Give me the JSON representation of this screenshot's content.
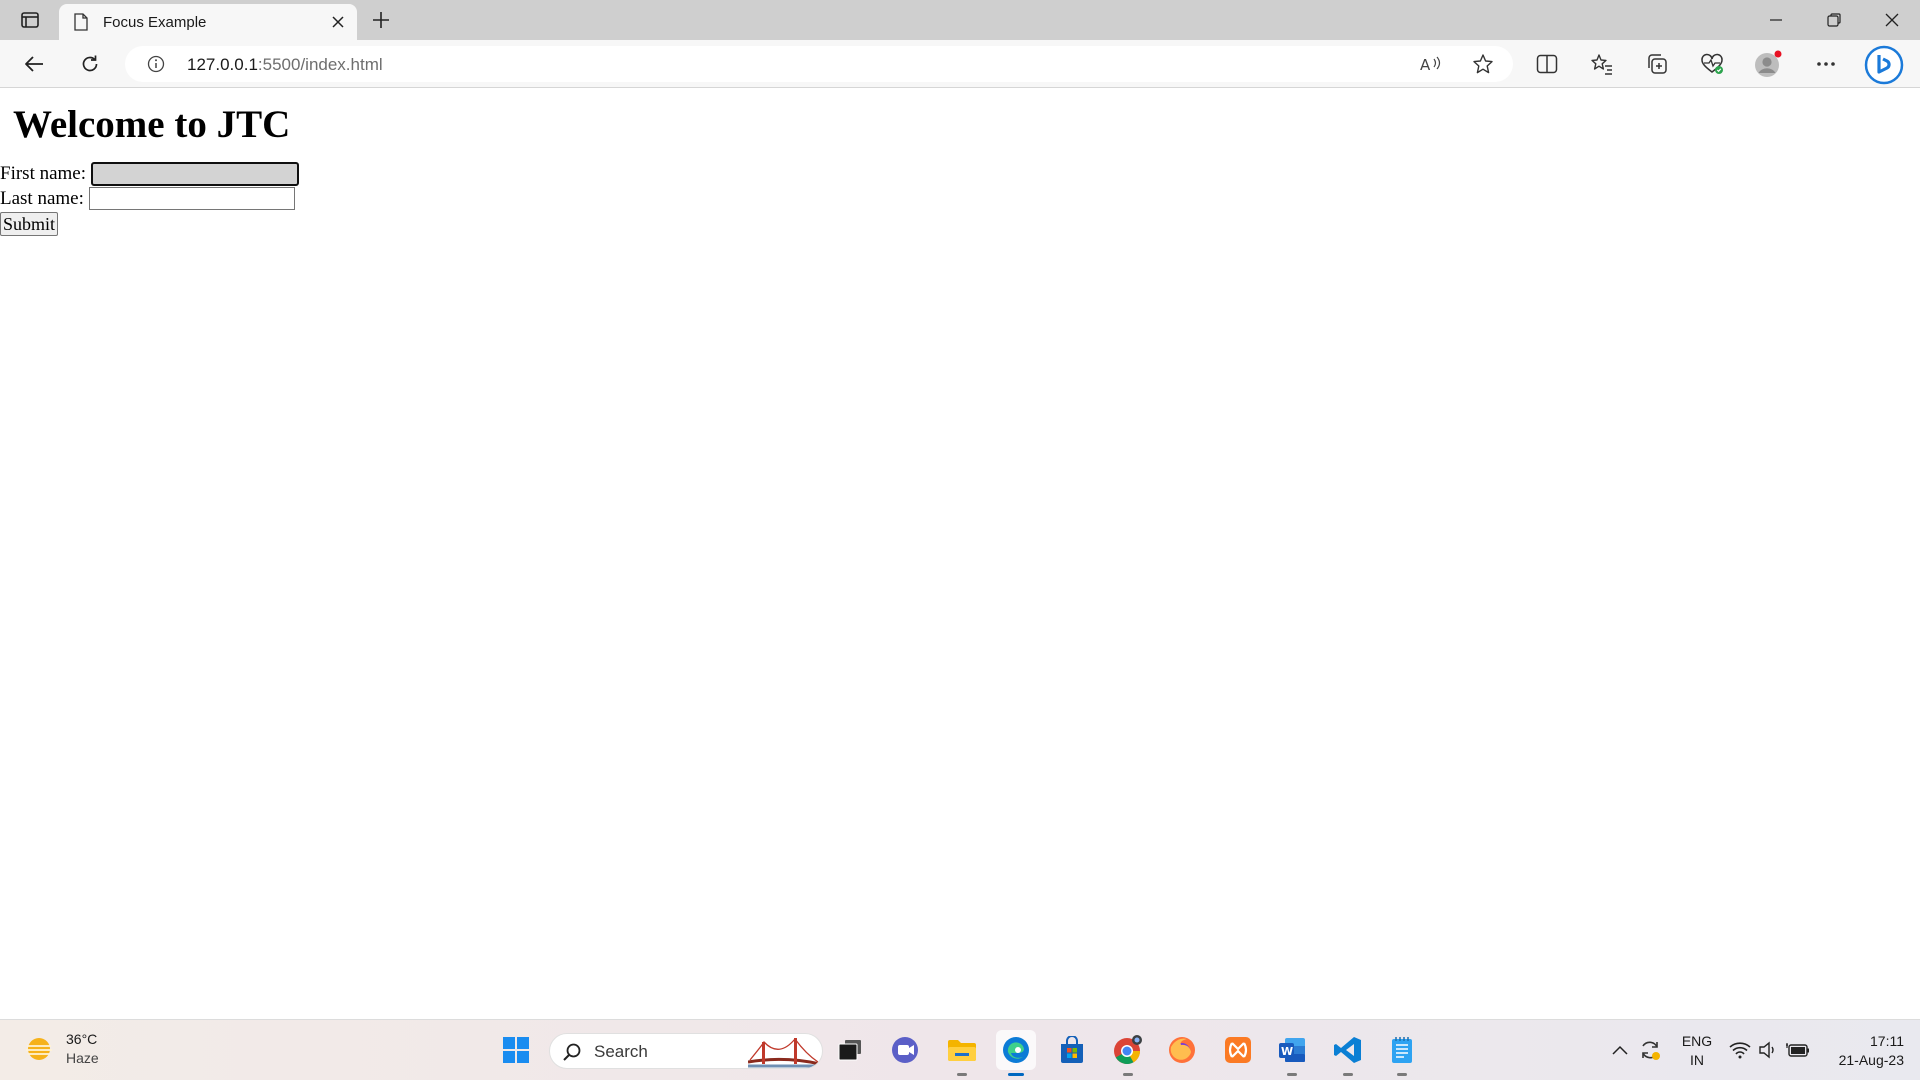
{
  "browser": {
    "tab": {
      "title": "Focus Example"
    },
    "address": {
      "host": "127.0.0.1",
      "path": ":5500/index.html"
    }
  },
  "page": {
    "heading": "Welcome to JTC",
    "form": {
      "first_name_label": "First name:",
      "first_name_value": "",
      "last_name_label": "Last name:",
      "last_name_value": "",
      "submit_label": "Submit",
      "focused_field": "first_name"
    }
  },
  "taskbar": {
    "weather": {
      "temp": "36°C",
      "condition": "Haze"
    },
    "search_placeholder": "Search",
    "apps": [
      "windows-start",
      "task-view",
      "teams-meet",
      "file-explorer",
      "edge",
      "microsoft-store",
      "chrome",
      "firefox",
      "xampp",
      "word",
      "vscode",
      "notepad"
    ],
    "language": {
      "line1": "ENG",
      "line2": "IN"
    },
    "clock": {
      "time": "17:11",
      "date": "21-Aug-23"
    }
  },
  "colors": {
    "tabstrip": "#cfcfcf",
    "toolbar": "#f7f7f7",
    "focused_input_bg": "#d3d3d3",
    "accent": "#0067c0"
  }
}
